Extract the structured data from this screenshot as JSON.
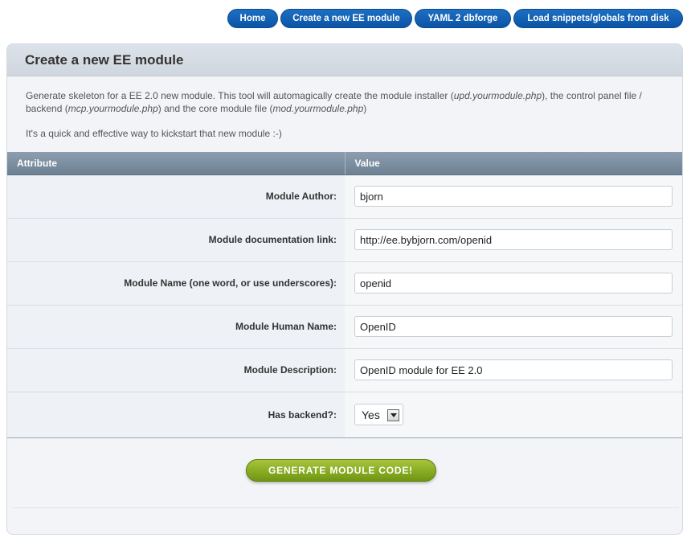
{
  "nav": {
    "items": [
      {
        "label": "Home"
      },
      {
        "label": "Create a new EE module"
      },
      {
        "label": "YAML 2 dbforge"
      },
      {
        "label": "Load snippets/globals from disk"
      }
    ]
  },
  "panel": {
    "title": "Create a new EE module",
    "intro": {
      "p1_a": "Generate skeleton for a EE 2.0 new module. This tool will automagically create the module installer (",
      "file1": "upd.yourmodule.php",
      "p1_b": "), the control panel file / backend (",
      "file2": "mcp.yourmodule.php",
      "p1_c": ") and the core module file (",
      "file3": "mod.yourmodule.php",
      "p1_d": ")",
      "p2": "It's a quick and effective way to kickstart that new module :-)"
    }
  },
  "table": {
    "headers": {
      "attribute": "Attribute",
      "value": "Value"
    },
    "rows": [
      {
        "label": "Module Author:",
        "value": "bjorn"
      },
      {
        "label": "Module documentation link:",
        "value": "http://ee.bybjorn.com/openid"
      },
      {
        "label": "Module Name (one word, or use underscores):",
        "value": "openid"
      },
      {
        "label": "Module Human Name:",
        "value": "OpenID"
      },
      {
        "label": "Module Description:",
        "value": "OpenID module for EE 2.0"
      }
    ],
    "backend": {
      "label": "Has backend?:",
      "selected": "Yes"
    }
  },
  "submit": {
    "label": "GENERATE MODULE CODE!"
  },
  "colors": {
    "nav_blue": "#0b54a6",
    "button_green": "#7fa31e",
    "header_slate": "#7b8fa1"
  }
}
